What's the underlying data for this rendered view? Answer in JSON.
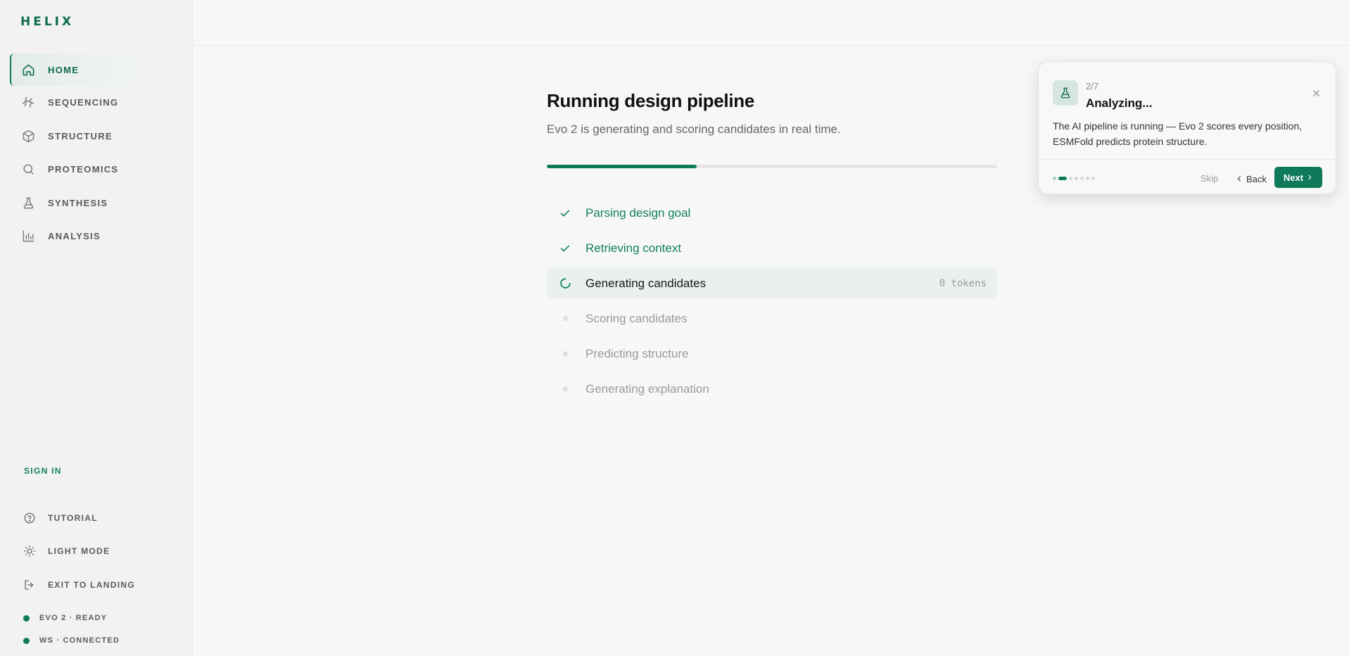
{
  "sidebar": {
    "brand": "HELIX",
    "nav": [
      {
        "label": "HOME",
        "icon": "home-icon",
        "active": true
      },
      {
        "label": "SEQUENCING",
        "icon": "dna-icon"
      },
      {
        "label": "STRUCTURE",
        "icon": "cube-icon"
      },
      {
        "label": "PROTEOMICS",
        "icon": "search-icon"
      },
      {
        "label": "SYNTHESIS",
        "icon": "flask-icon"
      },
      {
        "label": "ANALYSIS",
        "icon": "bar-chart-icon"
      }
    ],
    "sign_in": "SIGN IN",
    "bottom": [
      {
        "label": "TUTORIAL",
        "icon": "help-circle-icon"
      },
      {
        "label": "LIGHT MODE",
        "icon": "sun-icon"
      },
      {
        "label": "EXIT TO LANDING",
        "icon": "logout-icon"
      }
    ],
    "status": [
      {
        "label": "EVO 2 · READY",
        "color": "#0f7a5a"
      },
      {
        "label": "WS · CONNECTED",
        "color": "#0f7a5a"
      }
    ]
  },
  "main": {
    "title": "Running design pipeline",
    "subtitle": "Evo 2 is generating and scoring candidates in real time.",
    "progress_percent": 33.3,
    "steps": [
      {
        "label": "Parsing design goal",
        "state": "done"
      },
      {
        "label": "Retrieving context",
        "state": "done"
      },
      {
        "label": "Generating candidates",
        "state": "active",
        "meta": "0 tokens"
      },
      {
        "label": "Scoring candidates",
        "state": "pending"
      },
      {
        "label": "Predicting structure",
        "state": "pending"
      },
      {
        "label": "Generating explanation",
        "state": "pending"
      }
    ]
  },
  "tutorial": {
    "step": "2/7",
    "title": "Analyzing...",
    "body": "The AI pipeline is running — Evo 2 scores every position, ESMFold predicts protein structure.",
    "skip": "Skip",
    "back": "Back",
    "next": "Next",
    "total_steps": 7,
    "current_step": 2
  },
  "colors": {
    "accent": "#0f7a5a",
    "brand": "#0f6b50"
  }
}
